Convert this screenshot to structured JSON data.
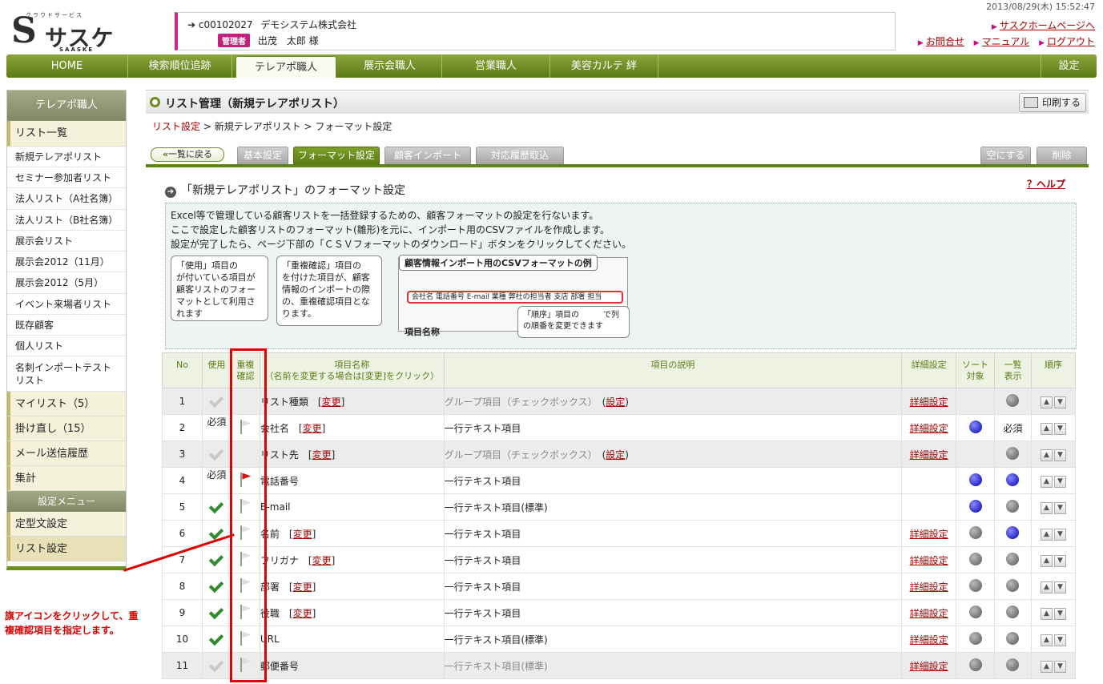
{
  "header": {
    "logo": {
      "kana": "クラウドサービス",
      "main": "サスケ",
      "en": "SAASKE"
    },
    "user": {
      "code": "c00102027",
      "company": "デモシステム株式会社",
      "badge": "管理者",
      "name": "出茂　太郎 様"
    },
    "datetime": "2013/08/29(木) 15:52:47",
    "links": {
      "home": "サスクホームページへ",
      "contact": "お問合せ",
      "manual": "マニュアル",
      "logout": "ログアウト"
    }
  },
  "nav": {
    "items": [
      "HOME",
      "検索順位追跡",
      "テレアポ職人",
      "展示会職人",
      "営業職人",
      "美容カルテ 絆"
    ],
    "settings": "設定"
  },
  "sidebar": {
    "title": "テレアポ職人",
    "items": [
      "リスト一覧",
      "新規テレアポリスト",
      "セミナー参加者リスト",
      "法人リスト（A社名簿）",
      "法人リスト（B社名簿）",
      "展示会リスト",
      "展示会2012（11月）",
      "展示会2012（5月）",
      "イベント来場者リスト",
      "既存顧客",
      "個人リスト",
      "名刺インポートテストリスト",
      "マイリスト（5）",
      "掛け直し（15）",
      "メール送信履歴",
      "集計"
    ],
    "settings_title": "設定メニュー",
    "settings_items": [
      "定型文設定",
      "リスト設定"
    ]
  },
  "page": {
    "title": "リスト管理（新規テレアポリスト）",
    "print": "印刷する",
    "breadcrumb": {
      "root": "リスト設定",
      "mid": " > 新規テレアポリスト > フォーマット設定"
    },
    "back": "一覧に戻る",
    "tabs": [
      "基本設定",
      "フォーマット設定",
      "顧客インポート",
      "対応履歴取込"
    ],
    "clear": "空にする",
    "delete": "削除",
    "section": "「新規テレアポリスト」のフォーマット設定",
    "help": "？ヘルプ",
    "info": [
      "Excel等で管理している顧客リストを一括登録するための、顧客フォーマットの設定を行ないます。",
      "ここで設定した顧客リストのフォーマット(雛形)を元に、インポート用のCSVファイルを作成します。",
      "設定が完了したら、ページ下部の「ＣＳＶフォーマットのダウンロード」ボタンをクリックしてください。"
    ],
    "bubble1": "「使用」項目の　　が付いている項目が顧客リストのフォーマットとして利用されます",
    "bubble2": "「重複確認」項目の　　を付けた項目が、顧客情報のインポートの際の、重複確認項目となります。",
    "csv_title": "顧客情報インポート用のCSVフォーマットの例",
    "csv_row": "会社名 電話番号 E-mail 業種 弊社の担当者 支店 部署 担当",
    "order_bubble": "「順序」項目の　　　で列の順番を変更できます",
    "colname": "項目名称"
  },
  "table": {
    "headers": {
      "no": "No",
      "use": "使用",
      "dup1": "重複",
      "dup2": "確認",
      "name1": "項目名称",
      "name2": "（名前を変更する場合は[変更]をクリック）",
      "desc": "項目の説明",
      "detail": "詳細設定",
      "sort1": "ソート",
      "sort2": "対象",
      "list1": "一覧",
      "list2": "表示",
      "order": "順序"
    },
    "rows": [
      {
        "no": "1",
        "name": "リスト種類",
        "change": "変更",
        "desc": "グループ項目（チェックボックス）",
        "desc_link": "設定",
        "detail": "詳細設定"
      },
      {
        "no": "2",
        "use": "必須",
        "name": "会社名",
        "change": "変更",
        "desc": "一行テキスト項目",
        "detail": "詳細設定",
        "list": "必須"
      },
      {
        "no": "3",
        "name": "リスト先",
        "change": "変更",
        "desc": "グループ項目（チェックボックス）",
        "desc_link": "設定",
        "detail": "詳細設定"
      },
      {
        "no": "4",
        "use": "必須",
        "name": "電話番号",
        "desc": "一行テキスト項目"
      },
      {
        "no": "5",
        "name": "E-mail",
        "desc": "一行テキスト項目(標準)"
      },
      {
        "no": "6",
        "name": "名前",
        "change": "変更",
        "desc": "一行テキスト項目",
        "detail": "詳細設定"
      },
      {
        "no": "7",
        "name": "フリガナ",
        "change": "変更",
        "desc": "一行テキスト項目",
        "detail": "詳細設定"
      },
      {
        "no": "8",
        "name": "部署",
        "change": "変更",
        "desc": "一行テキスト項目",
        "detail": "詳細設定"
      },
      {
        "no": "9",
        "name": "役職",
        "change": "変更",
        "desc": "一行テキスト項目",
        "detail": "詳細設定"
      },
      {
        "no": "10",
        "name": "URL",
        "desc": "一行テキスト項目(標準)",
        "detail": "詳細設定"
      },
      {
        "no": "11",
        "name": "郵便番号",
        "desc": "一行テキスト項目(標準)",
        "detail": "詳細設定"
      }
    ]
  },
  "annotation": {
    "line1": "旗アイコンをクリックして、重",
    "line2": "複確認項目を指定します。"
  }
}
